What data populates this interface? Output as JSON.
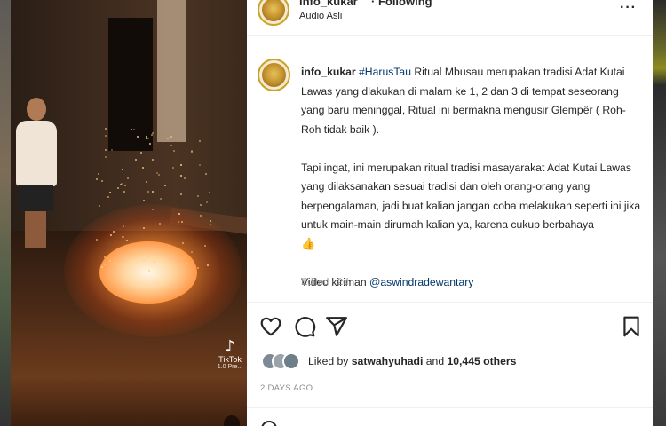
{
  "header": {
    "username": "info_kukar",
    "following_label": "· Following",
    "audio_label": "Audio Asli",
    "more_icon": "more-horizontal-icon"
  },
  "video": {
    "watermark_brand": "TikTok",
    "watermark_handle": "1.0 Pre..."
  },
  "caption": {
    "username": "info_kukar",
    "hashtag": "#HarusTau",
    "paragraph1": " Ritual Mbusau merupakan tradisi Adat Kutai Lawas yang dlakukan di malam ke 1, 2 dan 3 di tempat seseorang yang baru meninggal, Ritual ini bermakna mengusir Glempêr ( Roh-Roh tidak baik ).",
    "paragraph2": "Tapi ingat, ini merupakan ritual tradisi masayarakat Adat Kutai Lawas yang dilaksanakan sesuai tradisi dan oleh orang-orang yang berpengalaman, jadi buat kalian jangan coba melakukan seperti ini jika untuk main-main dirumah kalian ya, karena cukup berbahaya",
    "emoji": "👍",
    "credit_prefix": "Video kiriman ",
    "credit_mention": "@aswindradewantary",
    "edited": "Edited · 2d"
  },
  "actions": {
    "liked_prefix": "Liked by ",
    "liked_user": "satwahyuhadi",
    "liked_middle": " and ",
    "liked_count": "10,445 others",
    "timestamp": "2 DAYS AGO"
  },
  "colors": {
    "text": "#262626",
    "muted": "#8e8e8e",
    "link": "#00376b",
    "divider": "#efefef"
  }
}
